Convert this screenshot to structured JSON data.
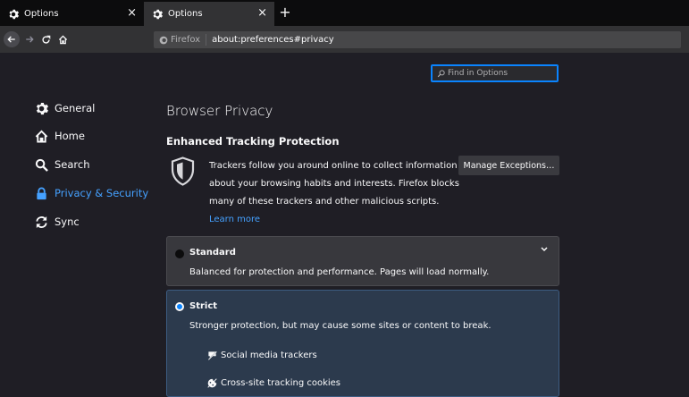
{
  "tabs": [
    {
      "label": "Options",
      "close": "×"
    },
    {
      "label": "Options",
      "close": "×"
    }
  ],
  "new_tab": "+",
  "nav": {
    "identity_label": "Firefox",
    "url": "about:preferences#privacy"
  },
  "search": {
    "placeholder": "Find in Options"
  },
  "sidebar": {
    "items": [
      {
        "label": "General",
        "icon": "gear-icon"
      },
      {
        "label": "Home",
        "icon": "home-icon"
      },
      {
        "label": "Search",
        "icon": "search-icon"
      },
      {
        "label": "Privacy & Security",
        "icon": "lock-icon",
        "active": true
      },
      {
        "label": "Sync",
        "icon": "sync-icon"
      }
    ]
  },
  "main": {
    "title": "Browser Privacy",
    "section_title": "Enhanced Tracking Protection",
    "description_lines": [
      "Trackers follow you around online to collect information",
      "about your browsing habits and interests. Firefox blocks",
      "many of these trackers and other malicious scripts."
    ],
    "learn_more": "Learn more",
    "manage_button": "Manage Exceptions…",
    "options": {
      "standard": {
        "title": "Standard",
        "description": "Balanced for protection and performance. Pages will load normally.",
        "selected": false
      },
      "strict": {
        "title": "Strict",
        "description": "Stronger protection, but may cause some sites or content to break.",
        "selected": true,
        "items": [
          {
            "label": "Social media trackers",
            "icon": "social-tracker-icon"
          },
          {
            "label": "Cross-site tracking cookies",
            "icon": "cookie-icon"
          }
        ]
      }
    }
  },
  "colors": {
    "accent": "#0a84ff",
    "link": "#45a1ff",
    "background": "#1f1e25"
  }
}
